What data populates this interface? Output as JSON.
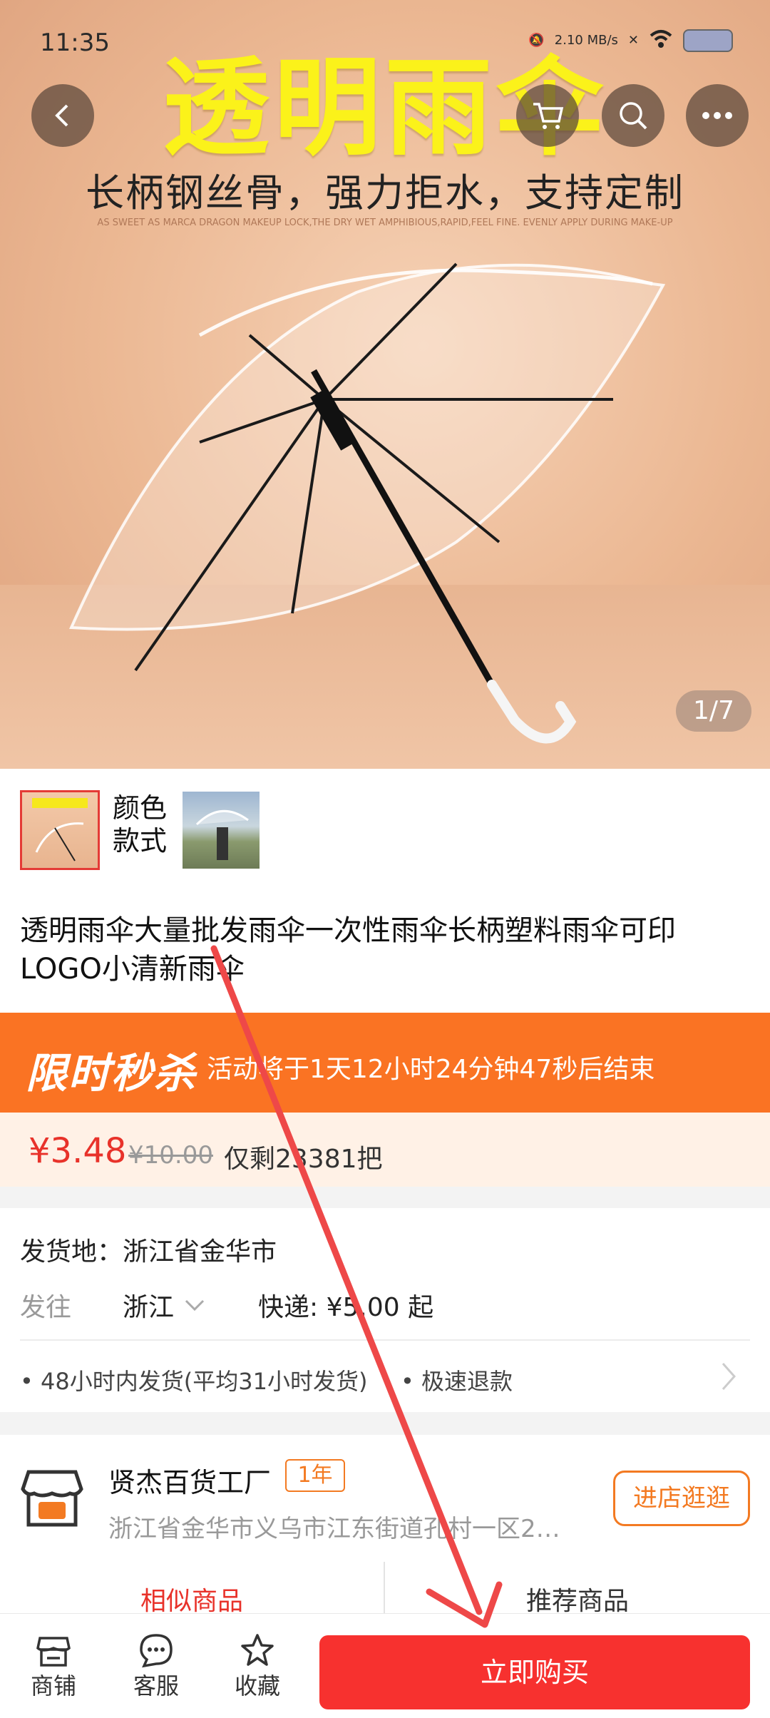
{
  "status": {
    "time": "11:35",
    "net_speed": "2.10 MB/s"
  },
  "hero": {
    "title": "透明雨伞",
    "subtitle": "长柄钢丝骨，强力拒水，支持定制",
    "tiny_text": "AS SWEET AS MARCA DRAGON MAKEUP LOCK,THE DRY WET AMPHIBIOUS,RAPID,FEEL FINE. EVENLY APPLY DURING MAKE-UP",
    "counter": "1/7"
  },
  "nav": {
    "back_icon": "back-icon",
    "cart_icon": "cart-icon",
    "search_icon": "search-icon",
    "more_icon": "more-icon"
  },
  "variant": {
    "label": "颜色\n款式"
  },
  "product": {
    "title": "透明雨伞大量批发雨伞一次性雨伞长柄塑料雨伞可印LOGO小清新雨伞"
  },
  "flash_sale": {
    "title": "限时秒杀",
    "countdown_text": "活动将于1天12小时24分钟47秒后结束",
    "price": "¥3.48",
    "original_price": "¥10.00",
    "stock": "仅剩23381把"
  },
  "shipping": {
    "origin": "发货地：浙江省金华市",
    "to_label": "发往",
    "destination": "浙江",
    "fee": "快递: ¥5.00 起",
    "guarantee_1": "48小时内发货(平均31小时发货)",
    "guarantee_2": "极速退款"
  },
  "store": {
    "name": "贤杰百货工厂",
    "badge": "1年",
    "address": "浙江省金华市义乌市江东街道孔村一区2…",
    "visit_button": "进店逛逛",
    "tab_similar": "相似商品",
    "tab_recommend": "推荐商品"
  },
  "bottom_bar": {
    "shop": "商铺",
    "service": "客服",
    "favorite": "收藏",
    "buy_now": "立即购买"
  },
  "colors": {
    "accent_red": "#f7312f",
    "flash_orange": "#fa7323",
    "price_red": "#e8322a"
  }
}
